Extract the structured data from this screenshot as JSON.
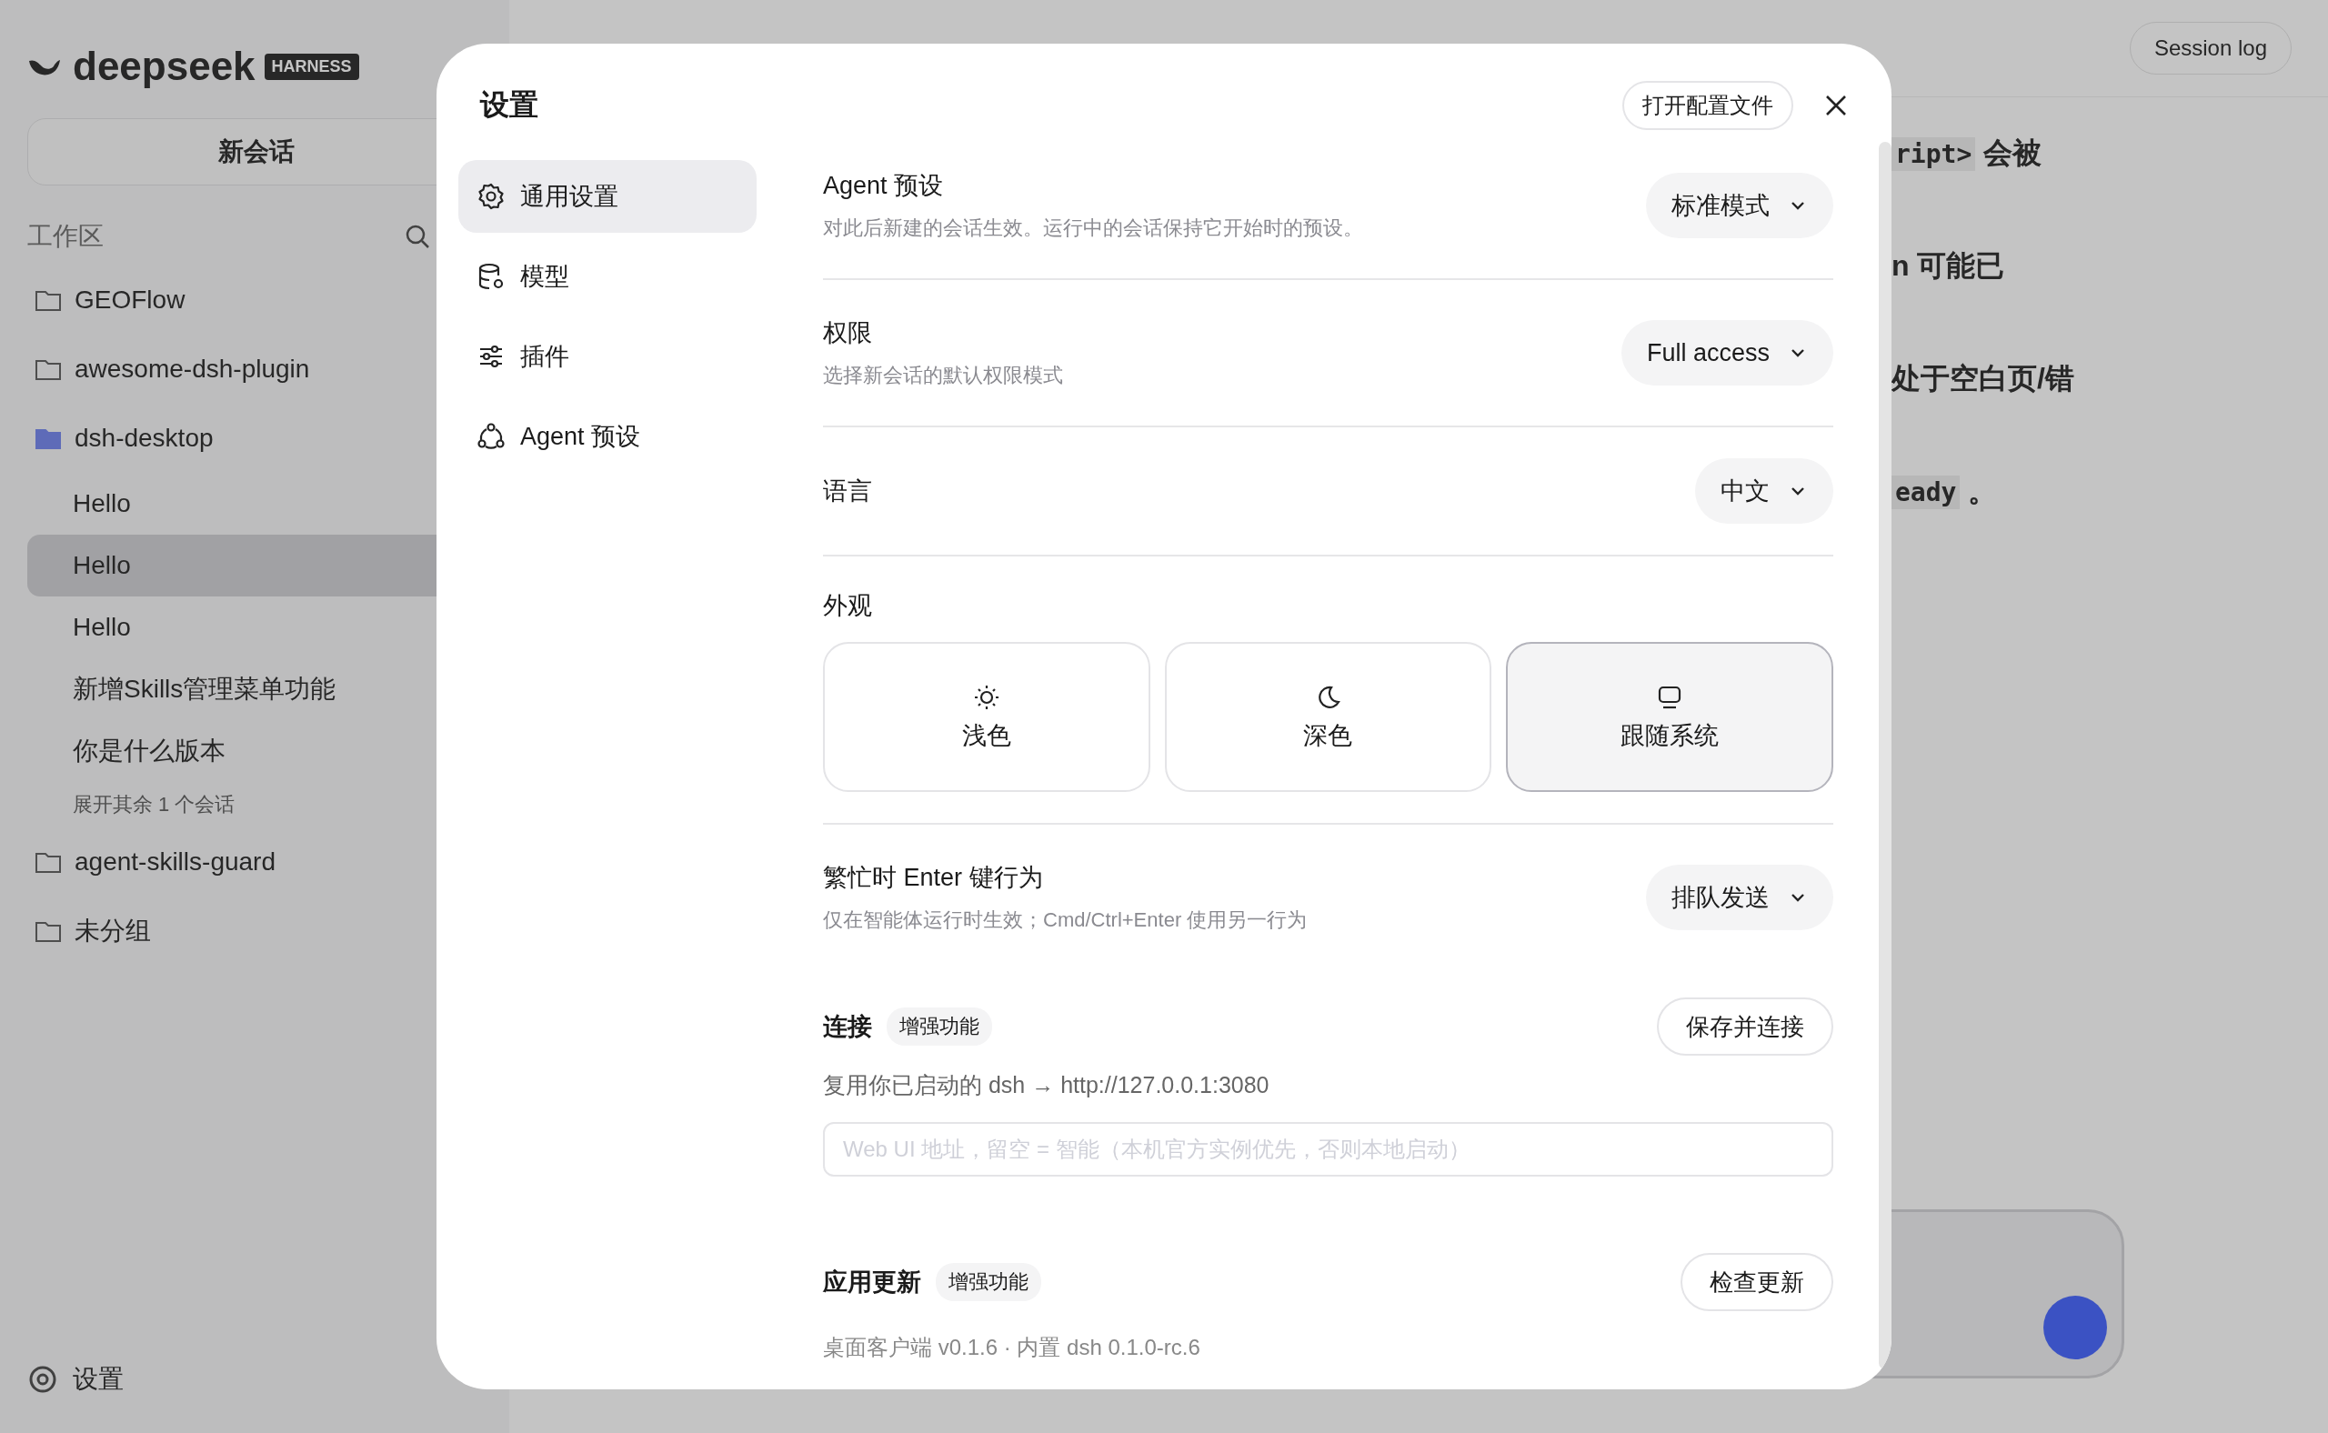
{
  "background": {
    "logo": "deepseek",
    "logo_badge": "HARNESS",
    "new_chat": "新会话",
    "workspace_label": "工作区",
    "projects": [
      {
        "name": "GEOFlow",
        "open": false
      },
      {
        "name": "awesome-dsh-plugin",
        "open": false
      },
      {
        "name": "dsh-desktop",
        "open": true,
        "children": [
          {
            "label": "Hello",
            "selected": false
          },
          {
            "label": "Hello",
            "selected": true
          },
          {
            "label": "Hello",
            "selected": false
          },
          {
            "label": "新增Skills管理菜单功能",
            "selected": false
          },
          {
            "label": "你是什么版本",
            "selected": false
          }
        ],
        "more": "展开其余 1 个会话"
      },
      {
        "name": "agent-skills-guard",
        "open": false
      },
      {
        "name": "未分组",
        "open": false
      }
    ],
    "settings_link": "设置",
    "session_log": "Session log",
    "fragments": [
      {
        "code": "ript>",
        "text": "会被"
      },
      {
        "text": "n 可能已"
      },
      {
        "text": "处于空白页/错"
      },
      {
        "code": "eady",
        "text": "。"
      }
    ]
  },
  "dialog": {
    "title": "设置",
    "open_config": "打开配置文件",
    "nav": [
      {
        "label": "通用设置",
        "selected": true
      },
      {
        "label": "模型",
        "selected": false
      },
      {
        "label": "插件",
        "selected": false
      },
      {
        "label": "Agent 预设",
        "selected": false
      }
    ],
    "rows": [
      {
        "kind": "dropdown",
        "title": "Agent 预设",
        "description": "对此后新建的会话生效。运行中的会话保持它开始时的预设。",
        "value": "标准模式"
      },
      {
        "kind": "dropdown",
        "title": "权限",
        "description": "选择新会话的默认权限模式",
        "value": "Full access"
      },
      {
        "kind": "dropdown",
        "title": "语言",
        "value": "中文"
      },
      {
        "kind": "appearance",
        "title": "外观",
        "options": [
          {
            "label": "浅色",
            "selected": false
          },
          {
            "label": "深色",
            "selected": false
          },
          {
            "label": "跟随系统",
            "selected": true
          }
        ]
      },
      {
        "kind": "dropdown",
        "title": "繁忙时 Enter 键行为",
        "description": "仅在智能体运行时生效；Cmd/Ctrl+Enter 使用另一行为",
        "value": "排队发送"
      },
      {
        "kind": "section",
        "title": "连接",
        "badge": "增强功能",
        "button": "保存并连接",
        "description": "复用你已启动的 dsh → http://127.0.0.1:3080",
        "placeholder": "Web UI 地址，留空 = 智能（本机官方实例优先，否则本地启动）"
      },
      {
        "kind": "section",
        "title": "应用更新",
        "badge": "增强功能",
        "button": "检查更新",
        "note": "桌面客户端 v0.1.6 · 内置 dsh 0.1.0-rc.6"
      }
    ]
  }
}
